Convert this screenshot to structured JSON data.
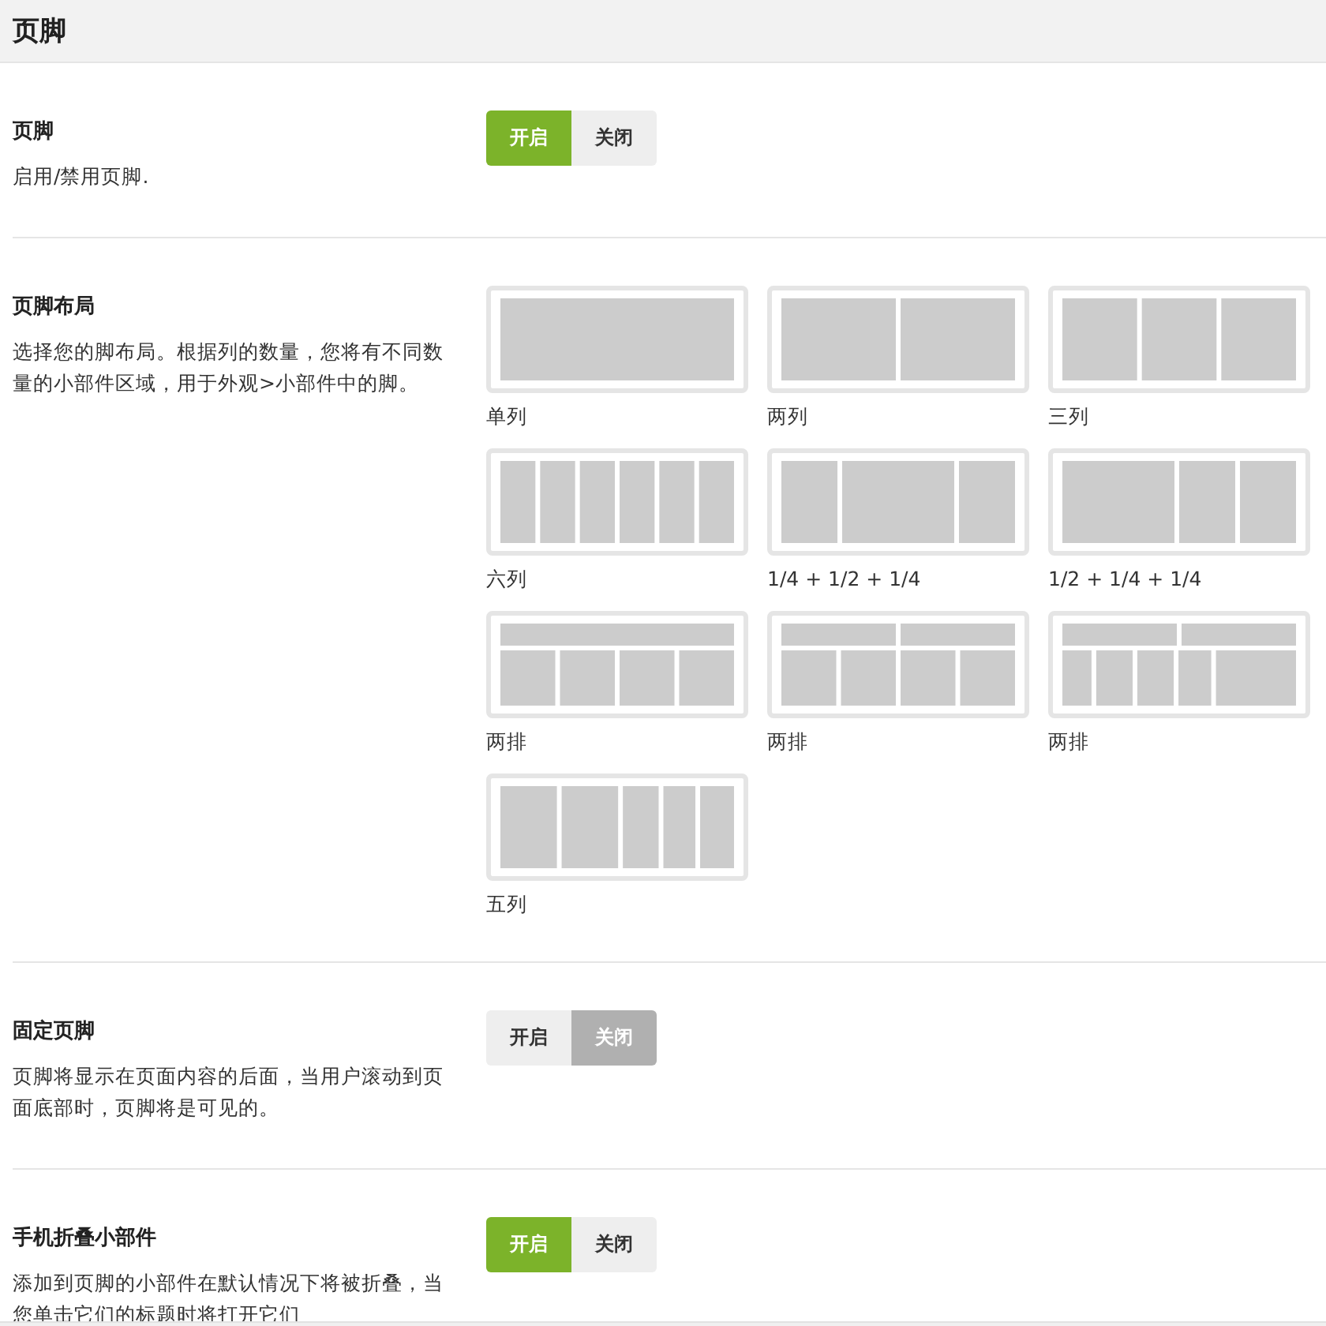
{
  "header": {
    "title": "页脚"
  },
  "settings": [
    {
      "kind": "toggle",
      "label": "页脚",
      "description": "启用/禁用页脚.",
      "options": [
        {
          "label": "开启",
          "kind": "on",
          "selected": true
        },
        {
          "label": "关闭",
          "kind": "off",
          "selected": false
        }
      ]
    },
    {
      "kind": "layouts",
      "label": "页脚布局",
      "description": "选择您的脚布局。根据列的数量，您将有不同数量的小部件区域，用于外观>小部件中的脚。",
      "layouts": [
        {
          "kind": "single",
          "label": "单列"
        },
        {
          "kind": "two",
          "label": "两列"
        },
        {
          "kind": "three",
          "label": "三列"
        },
        {
          "kind": "six",
          "label": "六列"
        },
        {
          "kind": "quarter-half-quarter",
          "label": "1/4 + 1/2 + 1/4"
        },
        {
          "kind": "half-quarter-quarter",
          "label": "1/2 + 1/4 + 1/4"
        },
        {
          "kind": "rows-one-four",
          "label": "两排"
        },
        {
          "kind": "rows-two-four",
          "label": "两排"
        },
        {
          "kind": "rows-two-five",
          "label": "两排"
        },
        {
          "kind": "five",
          "label": "五列"
        }
      ]
    },
    {
      "kind": "toggle",
      "label": "固定页脚",
      "description": "页脚将显示在页面内容的后面，当用户滚动到页面底部时，页脚将是可见的。",
      "options": [
        {
          "label": "开启",
          "kind": "on",
          "selected": false
        },
        {
          "label": "关闭",
          "kind": "off",
          "selected": true
        }
      ]
    },
    {
      "kind": "toggle",
      "label": "手机折叠小部件",
      "description": "添加到页脚的小部件在默认情况下将被折叠，当您单击它们的标题时将打开它们",
      "options": [
        {
          "label": "开启",
          "kind": "on",
          "selected": true
        },
        {
          "label": "关闭",
          "kind": "off",
          "selected": false
        }
      ]
    }
  ]
}
